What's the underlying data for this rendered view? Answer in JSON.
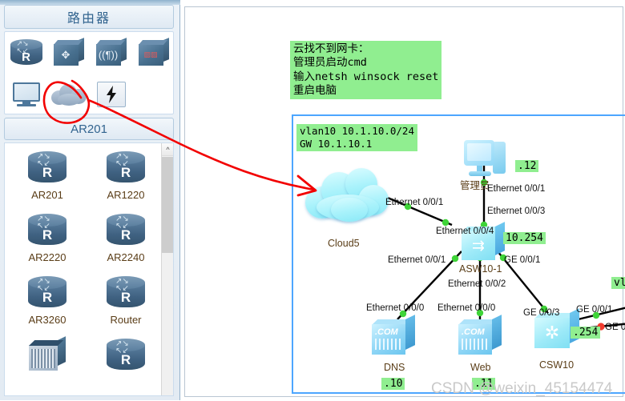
{
  "sidebar": {
    "header_title": "路由器",
    "palette": [
      {
        "name": "router-palette-icon",
        "icon": "router-icon"
      },
      {
        "name": "switch-palette-icon",
        "icon": "switch-icon"
      },
      {
        "name": "wlan-palette-icon",
        "icon": "wireless-ap-icon"
      },
      {
        "name": "firewall-palette-icon",
        "icon": "firewall-icon"
      },
      {
        "name": "endpoint-palette-icon",
        "icon": "pc-monitor-icon"
      },
      {
        "name": "cloud-palette-icon",
        "icon": "cloud-icon"
      },
      {
        "name": "connection-palette-icon",
        "icon": "lightning-bolt-icon"
      }
    ],
    "section_title": "AR201",
    "devices": [
      {
        "label": "AR201",
        "icon": "router-icon"
      },
      {
        "label": "AR1220",
        "icon": "router-icon"
      },
      {
        "label": "AR2220",
        "icon": "router-icon"
      },
      {
        "label": "AR2240",
        "icon": "router-icon"
      },
      {
        "label": "AR3260",
        "icon": "router-icon"
      },
      {
        "label": "Router",
        "icon": "router-icon"
      },
      {
        "label": "",
        "icon": "chassis-router-icon"
      },
      {
        "label": "",
        "icon": "router-icon"
      }
    ],
    "scroll_up_glyph": "^"
  },
  "canvas": {
    "notes": {
      "troubleshoot": "云找不到网卡：\n管理员启动cmd\n输入netsh winsock reset\n重启电脑",
      "vlan_info": "vlan10 10.1.10.0/24\nGW 10.1.10.1"
    },
    "tags": [
      {
        "name": "admin-pc-ip-tag",
        "text": ".12"
      },
      {
        "name": "asw-ip-tag",
        "text": "10.254"
      },
      {
        "name": "dns-ip-tag",
        "text": ".10"
      },
      {
        "name": "web-ip-tag",
        "text": ".11"
      },
      {
        "name": "csw-ip-tag",
        "text": ".254"
      },
      {
        "name": "vlan-right-tag",
        "text": "vla"
      }
    ],
    "nodes": [
      {
        "name": "cloud5-node",
        "label": "Cloud5",
        "icon": "cloud-icon"
      },
      {
        "name": "admin-pc-node",
        "label": "管理员",
        "icon": "pc-icon"
      },
      {
        "name": "asw10-1-node",
        "label": "ASW10-1",
        "icon": "switch-icon"
      },
      {
        "name": "dns-server-node",
        "label": "DNS",
        "icon": "server-icon"
      },
      {
        "name": "web-server-node",
        "label": "Web",
        "icon": "server-icon"
      },
      {
        "name": "csw10-node",
        "label": "CSW10",
        "icon": "core-switch-icon"
      }
    ],
    "interface_labels": [
      {
        "name": "if-cloud-eth0-0-1",
        "text": "Ethernet 0/0/1"
      },
      {
        "name": "if-admin-eth0-0-1",
        "text": "Ethernet 0/0/1"
      },
      {
        "name": "if-asw-eth0-0-3",
        "text": "Ethernet 0/0/3"
      },
      {
        "name": "if-asw-eth0-0-4",
        "text": "Ethernet 0/0/4"
      },
      {
        "name": "if-asw-eth0-0-1",
        "text": "Ethernet 0/0/1"
      },
      {
        "name": "if-asw-ge0-0-1",
        "text": "GE 0/0/1"
      },
      {
        "name": "if-asw-eth0-0-2",
        "text": "Ethernet 0/0/2"
      },
      {
        "name": "if-dns-eth0-0-0",
        "text": "Ethernet 0/0/0"
      },
      {
        "name": "if-web-eth0-0-0",
        "text": "Ethernet 0/0/0"
      },
      {
        "name": "if-csw-ge0-0-3",
        "text": "GE 0/0/3"
      },
      {
        "name": "if-csw-ge0-0-1",
        "text": "GE 0/0/1"
      },
      {
        "name": "if-csw-ge0-right",
        "text": "GE 0"
      }
    ],
    "watermark": "CSDN @weixin_45154474"
  },
  "colors": {
    "note_green": "#90ee90",
    "frame_blue": "#4da6ff",
    "annotation_red": "#f20000",
    "label_brown": "#5a3d17",
    "panel_header_text": "#32648f"
  }
}
